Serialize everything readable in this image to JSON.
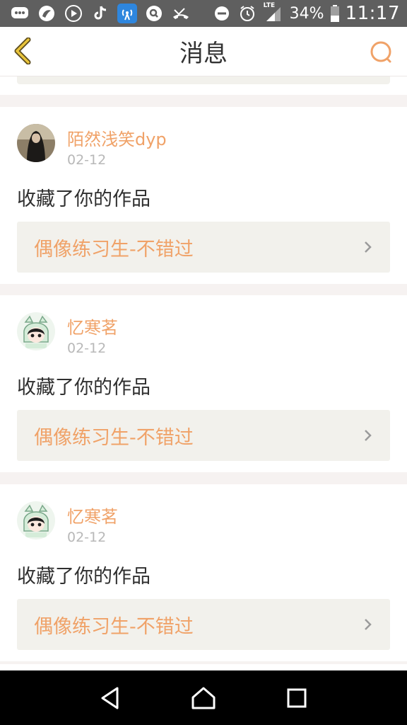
{
  "status_bar": {
    "battery": "34%",
    "time": "11:17",
    "network": "LTE",
    "left_icons": [
      "messages-icon",
      "browser-icon",
      "play-store-icon",
      "tiktok-icon",
      "wifi-hotspot-icon",
      "search-app-icon",
      "missed-call-icon"
    ],
    "right_icons": [
      "do-not-disturb-icon",
      "alarm-icon",
      "signal-icon",
      "battery-icon"
    ]
  },
  "header": {
    "title": "消息",
    "accent_color": "#f0a268"
  },
  "notifications": [
    {
      "username": "陌然浅笑dyp",
      "date": "02-12",
      "action": "收藏了你的作品",
      "work_title": "偶像练习生-不错过",
      "avatar": "dark-hair-avatar"
    },
    {
      "username": "忆寒茗",
      "date": "02-12",
      "action": "收藏了你的作品",
      "work_title": "偶像练习生-不错过",
      "avatar": "cartoon-girl-avatar"
    },
    {
      "username": "忆寒茗",
      "date": "02-12",
      "action": "收藏了你的作品",
      "work_title": "偶像练习生-不错过",
      "avatar": "cartoon-girl-avatar"
    }
  ],
  "nav": {
    "buttons": [
      "back-icon",
      "home-icon",
      "recents-icon"
    ]
  }
}
